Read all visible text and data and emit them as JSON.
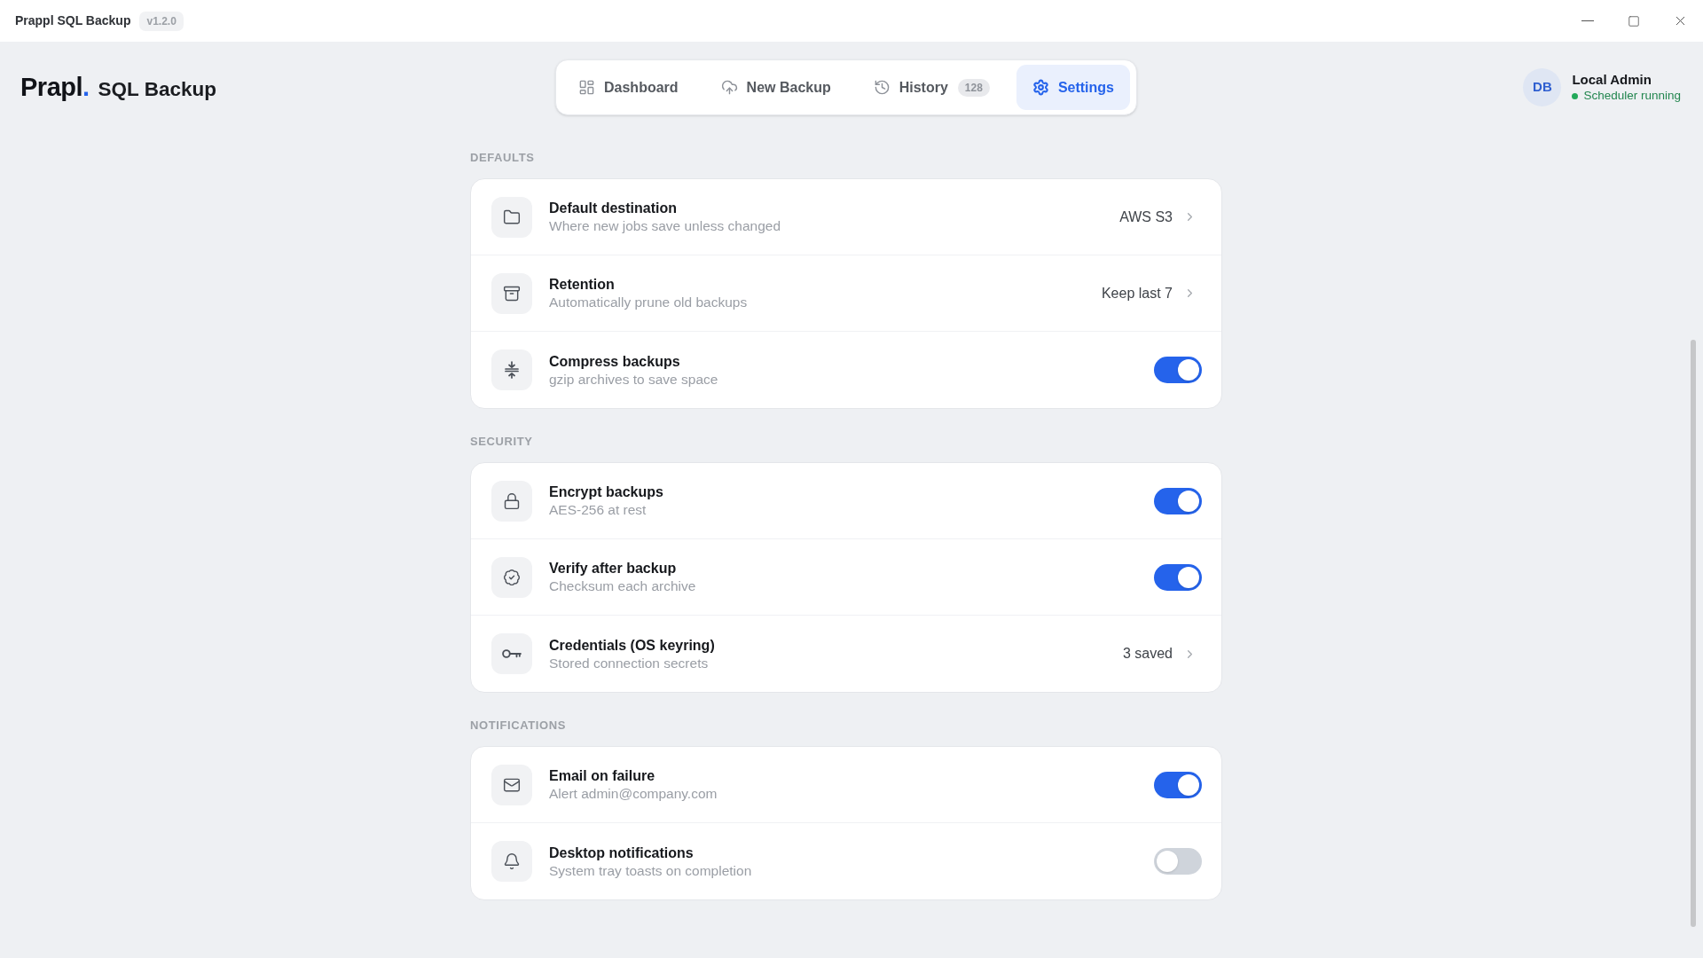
{
  "window": {
    "title": "Prappl SQL Backup",
    "version": "v1.2.0"
  },
  "header": {
    "logo_word": "Prapl",
    "logo_dot": ".",
    "product": "SQL Backup"
  },
  "nav": [
    {
      "label": "Dashboard",
      "selected": false
    },
    {
      "label": "New Backup",
      "selected": false
    },
    {
      "label": "History",
      "badge": "128",
      "selected": false
    },
    {
      "label": "Settings",
      "selected": true
    }
  ],
  "user": {
    "initials": "DB",
    "name": "Local Admin",
    "status": "Scheduler running"
  },
  "sections": [
    {
      "title": "DEFAULTS",
      "rows": [
        {
          "kind": "link",
          "title": "Default destination",
          "subtitle": "Where new jobs save unless changed",
          "value": "AWS S3"
        },
        {
          "kind": "link",
          "title": "Retention",
          "subtitle": "Automatically prune old backups",
          "value": "Keep last 7"
        },
        {
          "kind": "toggle",
          "title": "Compress backups",
          "subtitle": "gzip archives to save space",
          "on": true
        }
      ]
    },
    {
      "title": "SECURITY",
      "rows": [
        {
          "kind": "toggle",
          "title": "Encrypt backups",
          "subtitle": "AES-256 at rest",
          "on": true
        },
        {
          "kind": "toggle",
          "title": "Verify after backup",
          "subtitle": "Checksum each archive",
          "on": true
        },
        {
          "kind": "link",
          "title": "Credentials (OS keyring)",
          "subtitle": "Stored connection secrets",
          "value": "3 saved"
        }
      ]
    },
    {
      "title": "NOTIFICATIONS",
      "rows": [
        {
          "kind": "toggle",
          "title": "Email on failure",
          "subtitle": "Alert admin@company.com",
          "on": true
        },
        {
          "kind": "toggle",
          "title": "Desktop notifications",
          "subtitle": "System tray toasts on completion",
          "on": false
        }
      ]
    }
  ]
}
